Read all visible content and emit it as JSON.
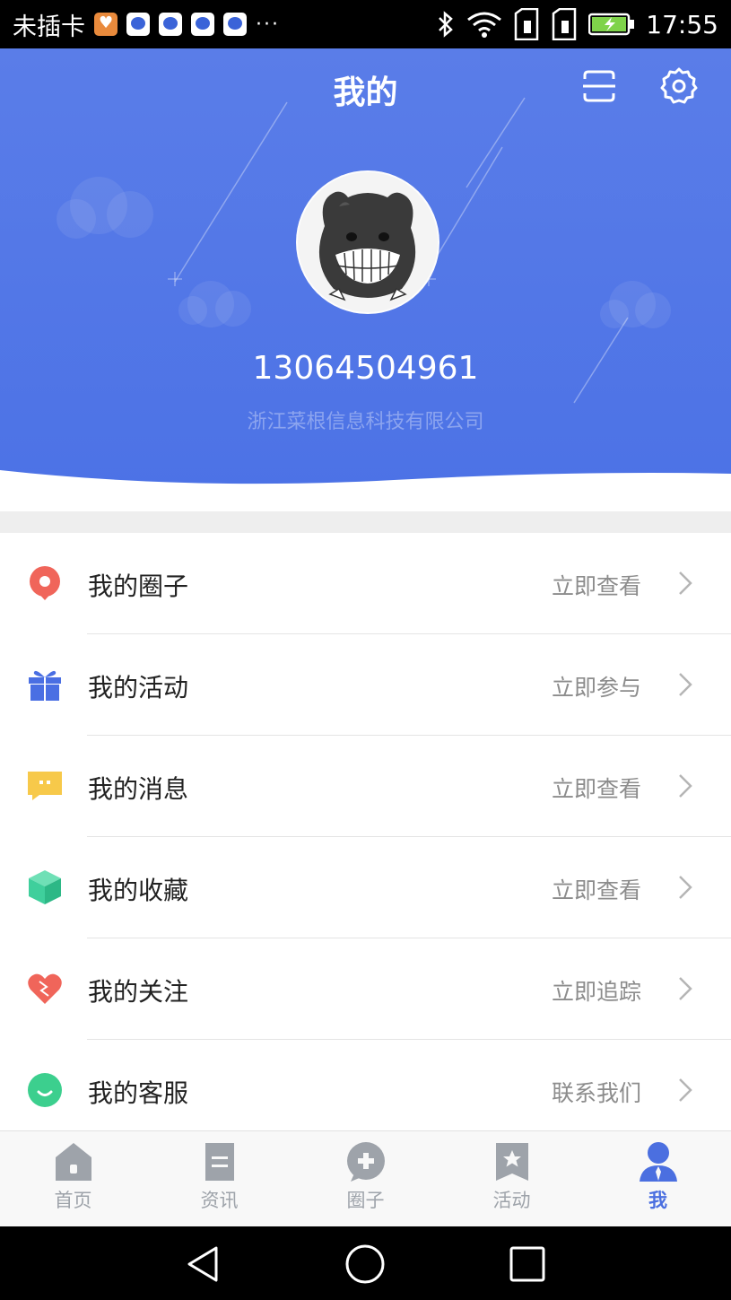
{
  "status_bar": {
    "carrier": "未插卡",
    "time": "17:55",
    "more": "···",
    "notification_icons": [
      "heart-notification-icon",
      "baidu-notification-icon",
      "baidu-notification-icon",
      "baidu-notification-icon",
      "baidu-notification-icon"
    ],
    "system_icons": [
      "bluetooth-icon",
      "wifi-icon",
      "sim-slot-icon",
      "sim-slot-icon",
      "battery-icon"
    ]
  },
  "header": {
    "title": "我的",
    "phone": "13064504961",
    "company": "浙江菜根信息科技有限公司",
    "scan_icon": "scan-icon",
    "settings_icon": "gear-icon"
  },
  "menu": [
    {
      "label": "我的圈子",
      "action": "立即查看",
      "icon": "location-pin-icon",
      "color": "#f0655a"
    },
    {
      "label": "我的活动",
      "action": "立即参与",
      "icon": "gift-icon",
      "color": "#4a6fe3"
    },
    {
      "label": "我的消息",
      "action": "立即查看",
      "icon": "message-icon",
      "color": "#f7c94a"
    },
    {
      "label": "我的收藏",
      "action": "立即查看",
      "icon": "cube-icon",
      "color": "#3fcf9c"
    },
    {
      "label": "我的关注",
      "action": "立即追踪",
      "icon": "heart-icon",
      "color": "#f0655a"
    },
    {
      "label": "我的客服",
      "action": "联系我们",
      "icon": "smile-icon",
      "color": "#3ccf8e"
    }
  ],
  "tabs": [
    {
      "label": "首页",
      "icon": "home-icon",
      "active": false
    },
    {
      "label": "资讯",
      "icon": "document-icon",
      "active": false
    },
    {
      "label": "圈子",
      "icon": "circle-plus-icon",
      "active": false
    },
    {
      "label": "活动",
      "icon": "star-bookmark-icon",
      "active": false
    },
    {
      "label": "我",
      "icon": "person-icon",
      "active": true
    }
  ],
  "colors": {
    "header_bg": "#4c72e6",
    "tab_active": "#4b6fe0",
    "tab_inactive": "#9ea3aa"
  }
}
